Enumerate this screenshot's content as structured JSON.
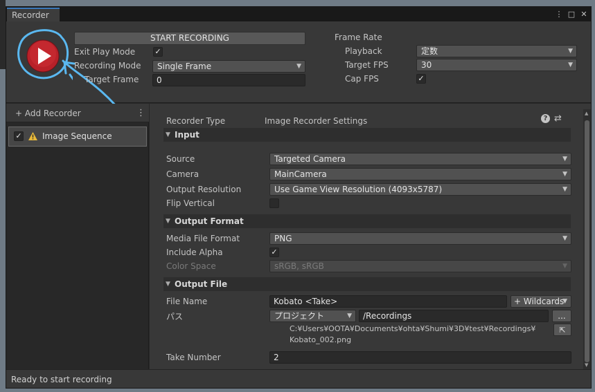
{
  "window": {
    "tab_title": "Recorder"
  },
  "top": {
    "start_label": "START RECORDING",
    "exit_play_mode_label": "Exit Play Mode",
    "recording_mode_label": "Recording Mode",
    "recording_mode_value": "Single Frame",
    "target_frame_label": "Target Frame",
    "target_frame_value": "0",
    "frame_rate_label": "Frame Rate",
    "playback_label": "Playback",
    "playback_value": "定数",
    "target_fps_label": "Target FPS",
    "target_fps_value": "30",
    "cap_fps_label": "Cap FPS"
  },
  "left": {
    "add_recorder_label": "+ Add Recorder",
    "items": [
      {
        "label": "Image Sequence"
      }
    ]
  },
  "right": {
    "recorder_type_label": "Recorder Type",
    "recorder_type_value": "Image Recorder Settings",
    "input_header": "Input",
    "source_label": "Source",
    "source_value": "Targeted Camera",
    "camera_label": "Camera",
    "camera_value": "MainCamera",
    "output_resolution_label": "Output Resolution",
    "output_resolution_value": "Use Game View Resolution (4093x5787)",
    "flip_vertical_label": "Flip Vertical",
    "output_format_header": "Output Format",
    "media_file_format_label": "Media File Format",
    "media_file_format_value": "PNG",
    "include_alpha_label": "Include Alpha",
    "color_space_label": "Color Space",
    "color_space_value": "sRGB, sRGB",
    "output_file_header": "Output File",
    "file_name_label": "File Name",
    "file_name_value": "Kobato  <Take>",
    "wildcards_label": "+ Wildcards",
    "path_label": "パス",
    "path_type_value": "プロジェクト",
    "path_value": "/Recordings",
    "browse_label": "...",
    "full_path_line1": "C:¥Users¥OOTA¥Documents¥ohta¥Shumi¥3D¥test¥Recordings¥",
    "full_path_line2": "Kobato_002.png",
    "take_number_label": "Take Number",
    "take_number_value": "2"
  },
  "status": {
    "text": "Ready to start recording"
  },
  "colors": {
    "accent": "#3a79bb",
    "play_red": "#c0242c",
    "annotation_blue": "#5ab8f0"
  }
}
